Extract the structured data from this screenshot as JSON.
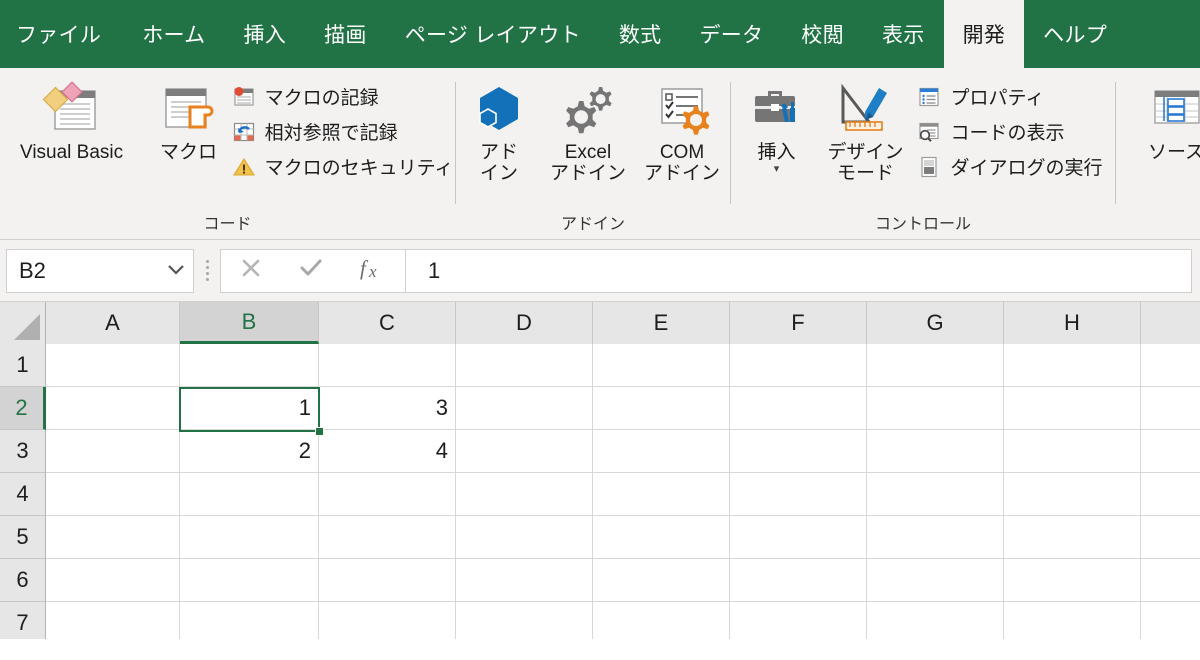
{
  "tabs": [
    {
      "label": "ファイル",
      "active": false
    },
    {
      "label": "ホーム",
      "active": false
    },
    {
      "label": "挿入",
      "active": false
    },
    {
      "label": "描画",
      "active": false
    },
    {
      "label": "ページ レイアウト",
      "active": false
    },
    {
      "label": "数式",
      "active": false
    },
    {
      "label": "データ",
      "active": false
    },
    {
      "label": "校閲",
      "active": false
    },
    {
      "label": "表示",
      "active": false
    },
    {
      "label": "開発",
      "active": true
    },
    {
      "label": "ヘルプ",
      "active": false
    }
  ],
  "ribbon": {
    "groups": [
      {
        "label": "コード",
        "big": [
          {
            "label": "Visual Basic",
            "icon": "visual-basic-icon"
          },
          {
            "label": "マクロ",
            "icon": "macro-icon"
          }
        ],
        "small": [
          {
            "label": "マクロの記録",
            "icon": "record-macro-icon"
          },
          {
            "label": "相対参照で記録",
            "icon": "relative-reference-icon"
          },
          {
            "label": "マクロのセキュリティ",
            "icon": "macro-security-warning-icon"
          }
        ]
      },
      {
        "label": "アドイン",
        "big": [
          {
            "label": "アド\nイン",
            "icon": "addins-hexagon-icon"
          },
          {
            "label": "Excel\nアドイン",
            "icon": "excel-addins-gears-icon"
          },
          {
            "label": "COM\nアドイン",
            "icon": "com-addins-checklist-icon"
          }
        ],
        "small": []
      },
      {
        "label": "コントロール",
        "big": [
          {
            "label": "挿入",
            "icon": "insert-control-toolbox-icon",
            "caret": "▾"
          },
          {
            "label": "デザイン\nモード",
            "icon": "design-mode-icon"
          }
        ],
        "small": [
          {
            "label": "プロパティ",
            "icon": "properties-icon"
          },
          {
            "label": "コードの表示",
            "icon": "view-code-icon"
          },
          {
            "label": "ダイアログの実行",
            "icon": "run-dialog-icon"
          }
        ]
      },
      {
        "label": "",
        "big": [
          {
            "label": "ソース",
            "icon": "xml-source-icon"
          }
        ],
        "small": []
      }
    ]
  },
  "formula_bar": {
    "name_box_value": "B2",
    "name_box_dropdown_icon": "chevron-down-icon",
    "cancel_icon": "cancel-x-icon",
    "enter_icon": "enter-check-icon",
    "function_icon": "insert-function-fx-icon",
    "formula_value": "1"
  },
  "grid": {
    "columns": [
      {
        "label": "A",
        "width": 134,
        "selected": false
      },
      {
        "label": "B",
        "width": 139,
        "selected": true
      },
      {
        "label": "C",
        "width": 137,
        "selected": false
      },
      {
        "label": "D",
        "width": 137,
        "selected": false
      },
      {
        "label": "E",
        "width": 137,
        "selected": false
      },
      {
        "label": "F",
        "width": 137,
        "selected": false
      },
      {
        "label": "G",
        "width": 137,
        "selected": false
      },
      {
        "label": "H",
        "width": 137,
        "selected": false
      },
      {
        "label": "",
        "width": 60,
        "selected": false
      }
    ],
    "rows": [
      {
        "label": "1",
        "selected": false,
        "cells": [
          "",
          "",
          "",
          "",
          "",
          "",
          "",
          "",
          ""
        ]
      },
      {
        "label": "2",
        "selected": true,
        "cells": [
          "",
          "1",
          "3",
          "",
          "",
          "",
          "",
          "",
          ""
        ]
      },
      {
        "label": "3",
        "selected": false,
        "cells": [
          "",
          "2",
          "4",
          "",
          "",
          "",
          "",
          "",
          ""
        ]
      },
      {
        "label": "4",
        "selected": false,
        "cells": [
          "",
          "",
          "",
          "",
          "",
          "",
          "",
          "",
          ""
        ]
      },
      {
        "label": "5",
        "selected": false,
        "cells": [
          "",
          "",
          "",
          "",
          "",
          "",
          "",
          "",
          ""
        ]
      },
      {
        "label": "6",
        "selected": false,
        "cells": [
          "",
          "",
          "",
          "",
          "",
          "",
          "",
          "",
          ""
        ]
      },
      {
        "label": "7",
        "selected": false,
        "cells": [
          "",
          "",
          "",
          "",
          "",
          "",
          "",
          "",
          ""
        ]
      }
    ],
    "active_cell": "B2"
  },
  "colors": {
    "brand_green": "#217346",
    "ribbon_bg": "#f3f2f1",
    "header_gray": "#e6e6e6",
    "selected_header_gray": "#d3d3d3",
    "gridline": "#d8d8d8"
  }
}
